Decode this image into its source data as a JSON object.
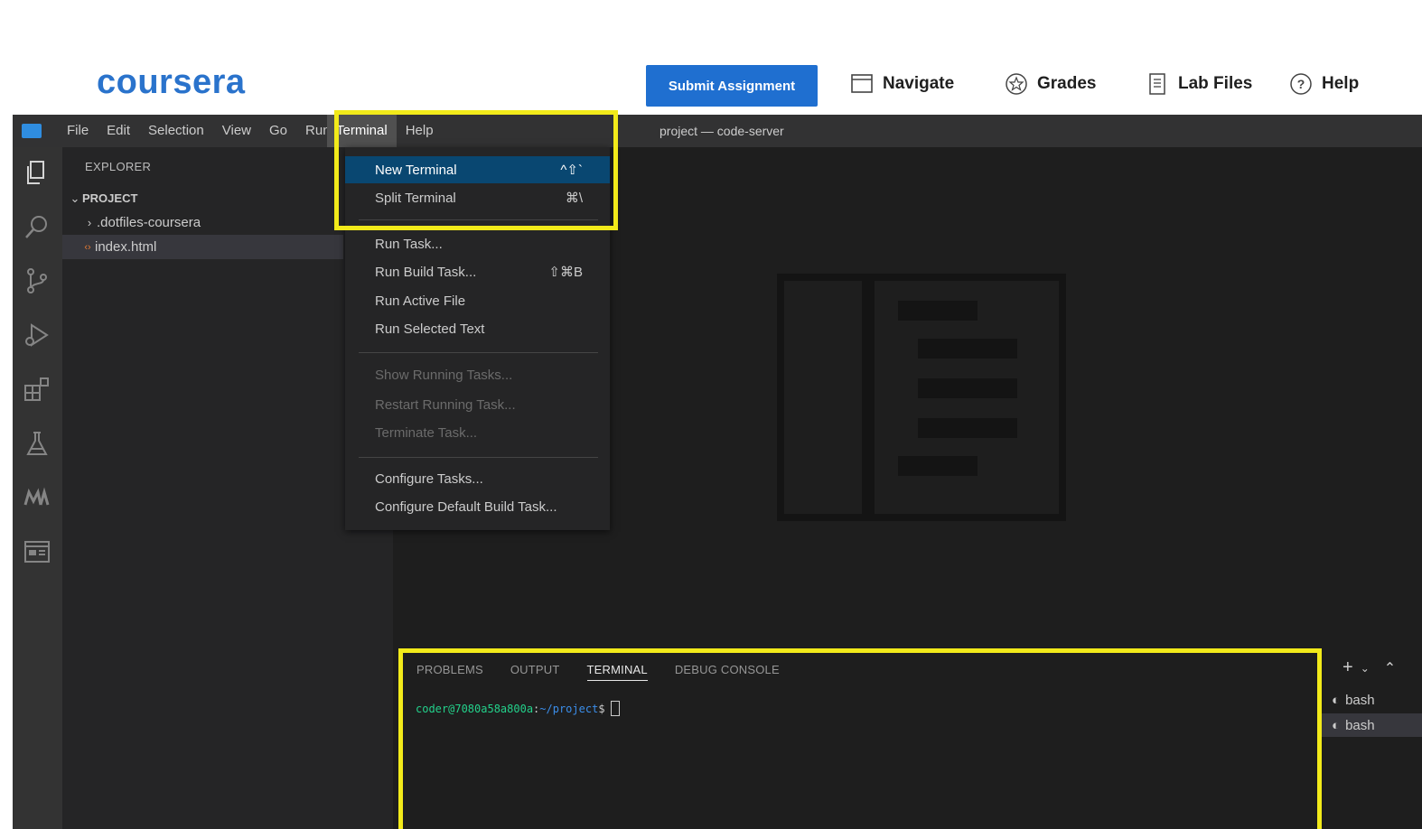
{
  "coursera": {
    "logo": "coursera",
    "submit_label": "Submit Assignment",
    "nav": [
      {
        "label": "Navigate",
        "icon": "window-icon"
      },
      {
        "label": "Grades",
        "icon": "star-badge-icon"
      },
      {
        "label": "Lab Files",
        "icon": "document-icon"
      },
      {
        "label": "Help",
        "icon": "question-icon"
      }
    ]
  },
  "ide": {
    "menu": [
      "File",
      "Edit",
      "Selection",
      "View",
      "Go",
      "Run",
      "Terminal",
      "Help"
    ],
    "active_menu": "Terminal",
    "window_title": "project — code-server",
    "explorer": {
      "title": "EXPLORER",
      "project": "PROJECT",
      "items": [
        {
          "label": ".dotfiles-coursera",
          "type": "folder"
        },
        {
          "label": "index.html",
          "type": "file"
        }
      ]
    },
    "terminal_menu": [
      {
        "label": "New Terminal",
        "shortcut": "^⇧`"
      },
      {
        "label": "Split Terminal",
        "shortcut": "⌘\\"
      },
      {
        "label": "Run Task...",
        "shortcut": ""
      },
      {
        "label": "Run Build Task...",
        "shortcut": "⇧⌘B"
      },
      {
        "label": "Run Active File",
        "shortcut": ""
      },
      {
        "label": "Run Selected Text",
        "shortcut": ""
      },
      {
        "label": "Show Running Tasks...",
        "shortcut": ""
      },
      {
        "label": "Restart Running Task...",
        "shortcut": ""
      },
      {
        "label": "Terminate Task...",
        "shortcut": ""
      },
      {
        "label": "Configure Tasks...",
        "shortcut": ""
      },
      {
        "label": "Configure Default Build Task...",
        "shortcut": ""
      }
    ],
    "panel": {
      "tabs": [
        "PROBLEMS",
        "OUTPUT",
        "TERMINAL",
        "DEBUG CONSOLE"
      ],
      "active_tab": "TERMINAL",
      "prompt_user": "coder@7080a58a800a",
      "prompt_sep": ":",
      "prompt_path": "~/project",
      "prompt_dollar": "$"
    },
    "terminals": [
      "bash",
      "bash"
    ]
  },
  "colors": {
    "highlight": "#f2ea1a",
    "coursera_blue": "#2a73cc",
    "button_blue": "#1f6fd0",
    "menu_selected": "#094771"
  }
}
